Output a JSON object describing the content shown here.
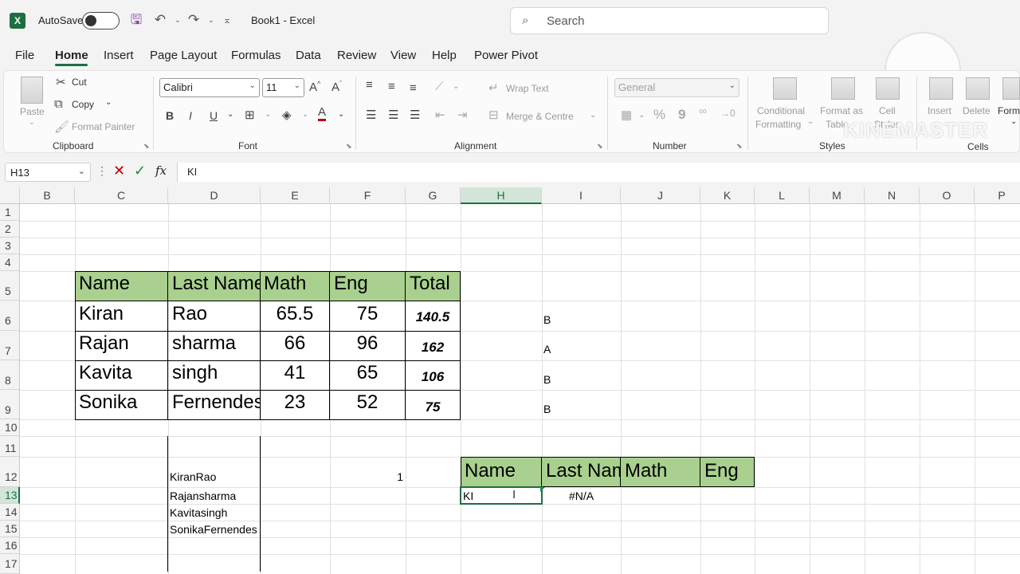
{
  "titlebar": {
    "autosave_label": "AutoSave",
    "doc_title": "Book1  -  Excel",
    "search_placeholder": "Search"
  },
  "menu": {
    "tabs": [
      "File",
      "Home",
      "Insert",
      "Page Layout",
      "Formulas",
      "Data",
      "Review",
      "View",
      "Help",
      "Power Pivot"
    ],
    "active": "Home"
  },
  "ribbon": {
    "clipboard": {
      "paste": "Paste",
      "cut": "Cut",
      "copy": "Copy",
      "format_painter": "Format Painter",
      "group": "Clipboard"
    },
    "font": {
      "name": "Calibri",
      "size": "11",
      "group": "Font",
      "bold": "B",
      "italic": "I",
      "underline": "U"
    },
    "alignment": {
      "wrap_text": "Wrap Text",
      "merge": "Merge & Centre",
      "group": "Alignment"
    },
    "number": {
      "format": "General",
      "percent": "%",
      "comma": "9",
      "group": "Number"
    },
    "styles": {
      "conditional": "Conditional",
      "formatting": "Formatting",
      "format_as": "Format as",
      "table": "Table",
      "cell": "Cell",
      "styles_word": "Styles",
      "group": "Styles"
    },
    "cells": {
      "insert": "Insert",
      "delete": "Delete",
      "format": "Form",
      "group": "Cells"
    }
  },
  "watermark": "KINEMASTER",
  "formula_bar": {
    "name_box": "H13",
    "fx": "fx",
    "content": "KI"
  },
  "grid": {
    "columns": [
      "B",
      "C",
      "D",
      "E",
      "F",
      "G",
      "H",
      "I",
      "J",
      "K",
      "L",
      "M",
      "N",
      "O",
      "P"
    ],
    "rows": [
      "1",
      "2",
      "3",
      "4",
      "5",
      "6",
      "7",
      "8",
      "9",
      "10",
      "11",
      "12",
      "13",
      "14",
      "15",
      "16",
      "17"
    ],
    "selected_column": "H",
    "selected_row": "13"
  },
  "table1": {
    "headers": [
      "Name",
      "Last Name",
      "Math",
      "Eng",
      "Total"
    ],
    "rows": [
      [
        "Kiran",
        "Rao",
        "65.5",
        "75",
        "140.5"
      ],
      [
        "Rajan",
        "sharma",
        "66",
        "96",
        "162"
      ],
      [
        "Kavita",
        "singh",
        "41",
        "65",
        "106"
      ],
      [
        "Sonika",
        "Fernendes",
        "23",
        "52",
        "75"
      ]
    ],
    "grades": [
      "B",
      "A",
      "B",
      "B"
    ]
  },
  "concat_list": [
    "KiranRao",
    "Rajansharma",
    "Kavitasingh",
    "SonikaFernendes"
  ],
  "f12_value": "1",
  "table2": {
    "headers": [
      "Name",
      "Last Name",
      "Math",
      "Eng"
    ],
    "h13_value": "KI",
    "i13_value": "#N/A"
  }
}
